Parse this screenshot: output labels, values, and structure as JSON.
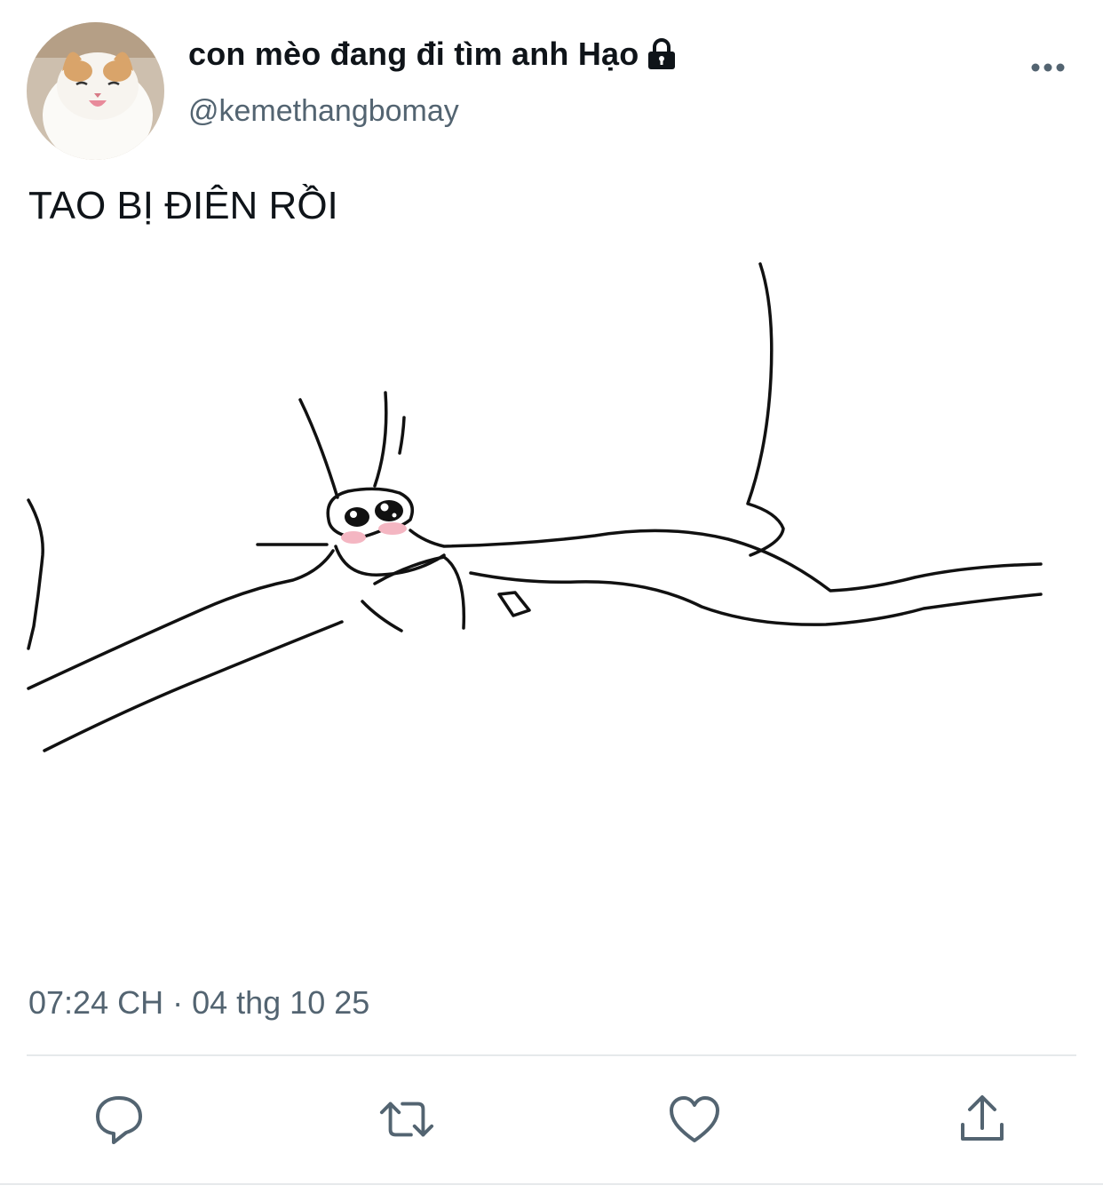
{
  "tweet": {
    "author": {
      "display_name": "con mèo đang đi tìm anh Hạo",
      "handle": "@kemethangbomay",
      "avatar_icon": "cat-avatar",
      "protected_icon": "lock-icon"
    },
    "text": "TAO BỊ ĐIÊN RỒI",
    "timestamp": "07:24 CH · 04 thg 10 25",
    "media_icon": "stick-figure-drawing"
  },
  "actions": [
    {
      "name": "reply",
      "icon": "reply-icon"
    },
    {
      "name": "retweet",
      "icon": "retweet-icon"
    },
    {
      "name": "like",
      "icon": "heart-icon"
    },
    {
      "name": "share",
      "icon": "share-icon"
    }
  ],
  "colors": {
    "text_primary": "#0f1419",
    "text_secondary": "#536471",
    "icon": "#536471",
    "divider": "#e6e9eb",
    "blush": "#f4b6c2"
  }
}
